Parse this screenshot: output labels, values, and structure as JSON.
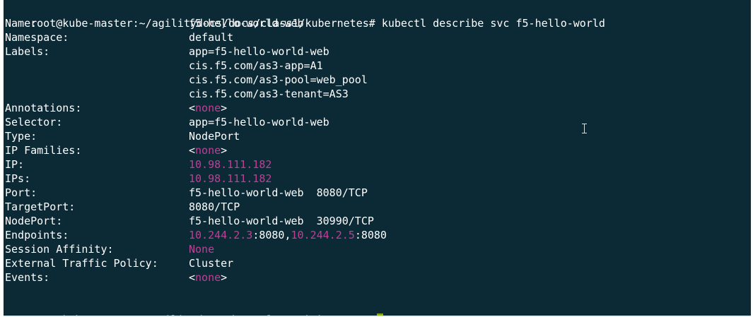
{
  "terminal": {
    "prompt": "root@kube-master:~/agilitydocs/docs/class1/kubernetes#",
    "command": "kubectl describe svc f5-hello-world",
    "fields": {
      "name": {
        "label": "Name:",
        "value": "f5-hello-world-web"
      },
      "namespace": {
        "label": "Namespace:",
        "value": "default"
      },
      "labels": {
        "label": "Labels:",
        "values": [
          "app=f5-hello-world-web",
          "cis.f5.com/as3-app=A1",
          "cis.f5.com/as3-pool=web_pool",
          "cis.f5.com/as3-tenant=AS3"
        ]
      },
      "annotations": {
        "label": "Annotations:",
        "lt": "<",
        "value": "none",
        "gt": ">"
      },
      "selector": {
        "label": "Selector:",
        "value": "app=f5-hello-world-web"
      },
      "type": {
        "label": "Type:",
        "value": "NodePort"
      },
      "ip_families": {
        "label": "IP Families:",
        "lt": "<",
        "value": "none",
        "gt": ">"
      },
      "ip": {
        "label": "IP:",
        "value": "10.98.111.182"
      },
      "ips": {
        "label": "IPs:",
        "value": "10.98.111.182"
      },
      "port": {
        "label": "Port:",
        "value": "f5-hello-world-web  8080/TCP"
      },
      "target_port": {
        "label": "TargetPort:",
        "value": "8080/TCP"
      },
      "node_port": {
        "label": "NodePort:",
        "value": "f5-hello-world-web  30990/TCP"
      },
      "endpoints": {
        "label": "Endpoints:",
        "ep1_ip": "10.244.2.3",
        "ep1_port": ":8080,",
        "ep2_ip": "10.244.2.5",
        "ep2_port": ":8080"
      },
      "session_affinity": {
        "label": "Session Affinity:",
        "value": "None"
      },
      "external_traffic_policy": {
        "label": "External Traffic Policy:",
        "value": "Cluster"
      },
      "events": {
        "label": "Events:",
        "lt": "<",
        "value": "none",
        "gt": ">"
      }
    }
  },
  "colors": {
    "background": "#0c2a36",
    "text": "#ffffff",
    "highlight": "#c03e95",
    "cursor": "#8aa610"
  }
}
